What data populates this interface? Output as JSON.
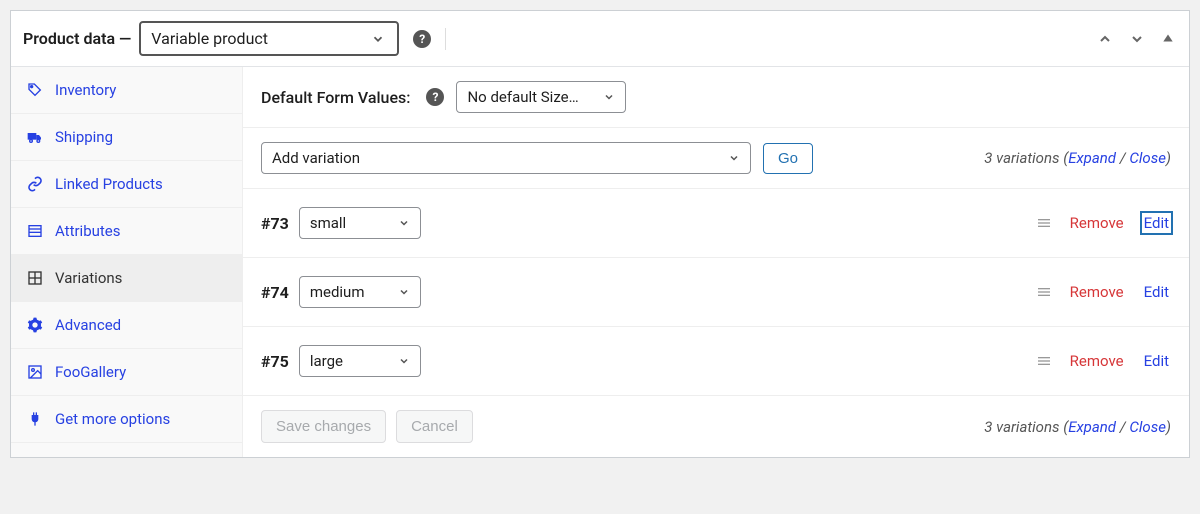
{
  "header": {
    "title": "Product data —",
    "product_type": "Variable product"
  },
  "sidebar": {
    "items": [
      {
        "icon": "tag-icon",
        "label": "Inventory"
      },
      {
        "icon": "truck-icon",
        "label": "Shipping"
      },
      {
        "icon": "link-icon",
        "label": "Linked Products"
      },
      {
        "icon": "list-icon",
        "label": "Attributes"
      },
      {
        "icon": "grid-icon",
        "label": "Variations"
      },
      {
        "icon": "gear-icon",
        "label": "Advanced"
      },
      {
        "icon": "gallery-icon",
        "label": "FooGallery"
      },
      {
        "icon": "plug-icon",
        "label": "Get more options"
      }
    ]
  },
  "defaults": {
    "label": "Default Form Values:",
    "select_value": "No default Size…"
  },
  "action_bar": {
    "select_value": "Add variation",
    "go_label": "Go",
    "count_text": "3 variations",
    "expand_label": "Expand",
    "close_label": "Close"
  },
  "variations": [
    {
      "id": "#73",
      "value": "small"
    },
    {
      "id": "#74",
      "value": "medium"
    },
    {
      "id": "#75",
      "value": "large"
    }
  ],
  "row_actions": {
    "remove": "Remove",
    "edit": "Edit"
  },
  "footer": {
    "save": "Save changes",
    "cancel": "Cancel",
    "count_text": "3 variations",
    "expand_label": "Expand",
    "close_label": "Close"
  }
}
